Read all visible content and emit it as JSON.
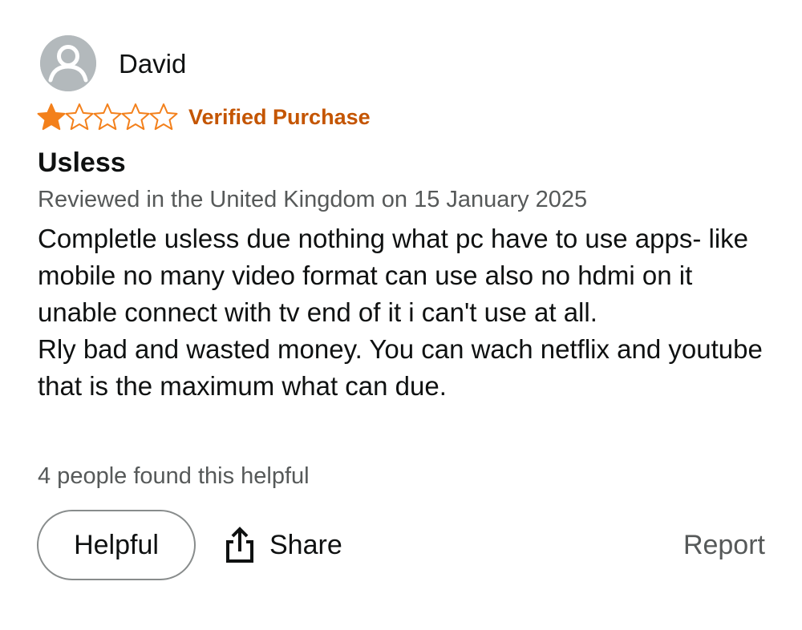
{
  "review": {
    "username": "David",
    "rating": 1,
    "rating_max": 5,
    "verified_label": "Verified Purchase",
    "title": "Usless",
    "meta": "Reviewed in the United Kingdom on 15 January 2025",
    "body_lines": [
      "Completle usless due nothing what pc have to use apps- like mobile no many video format can use also no hdmi on it unable connect with tv end of it i can't use at all.",
      "Rly bad and wasted money. You can wach netflix and youtube that is the maximum what can due."
    ],
    "helpful_count_text": "4 people found this helpful"
  },
  "actions": {
    "helpful_label": "Helpful",
    "share_label": "Share",
    "report_label": "Report"
  },
  "icons": {
    "avatar": "user-avatar-icon",
    "star_filled": "star-filled-icon",
    "star_empty": "star-empty-icon",
    "share": "share-icon"
  },
  "colors": {
    "star": "#f3801b",
    "verified": "#c45500",
    "meta_text": "#565959",
    "avatar_bg": "#b3b9bc"
  }
}
